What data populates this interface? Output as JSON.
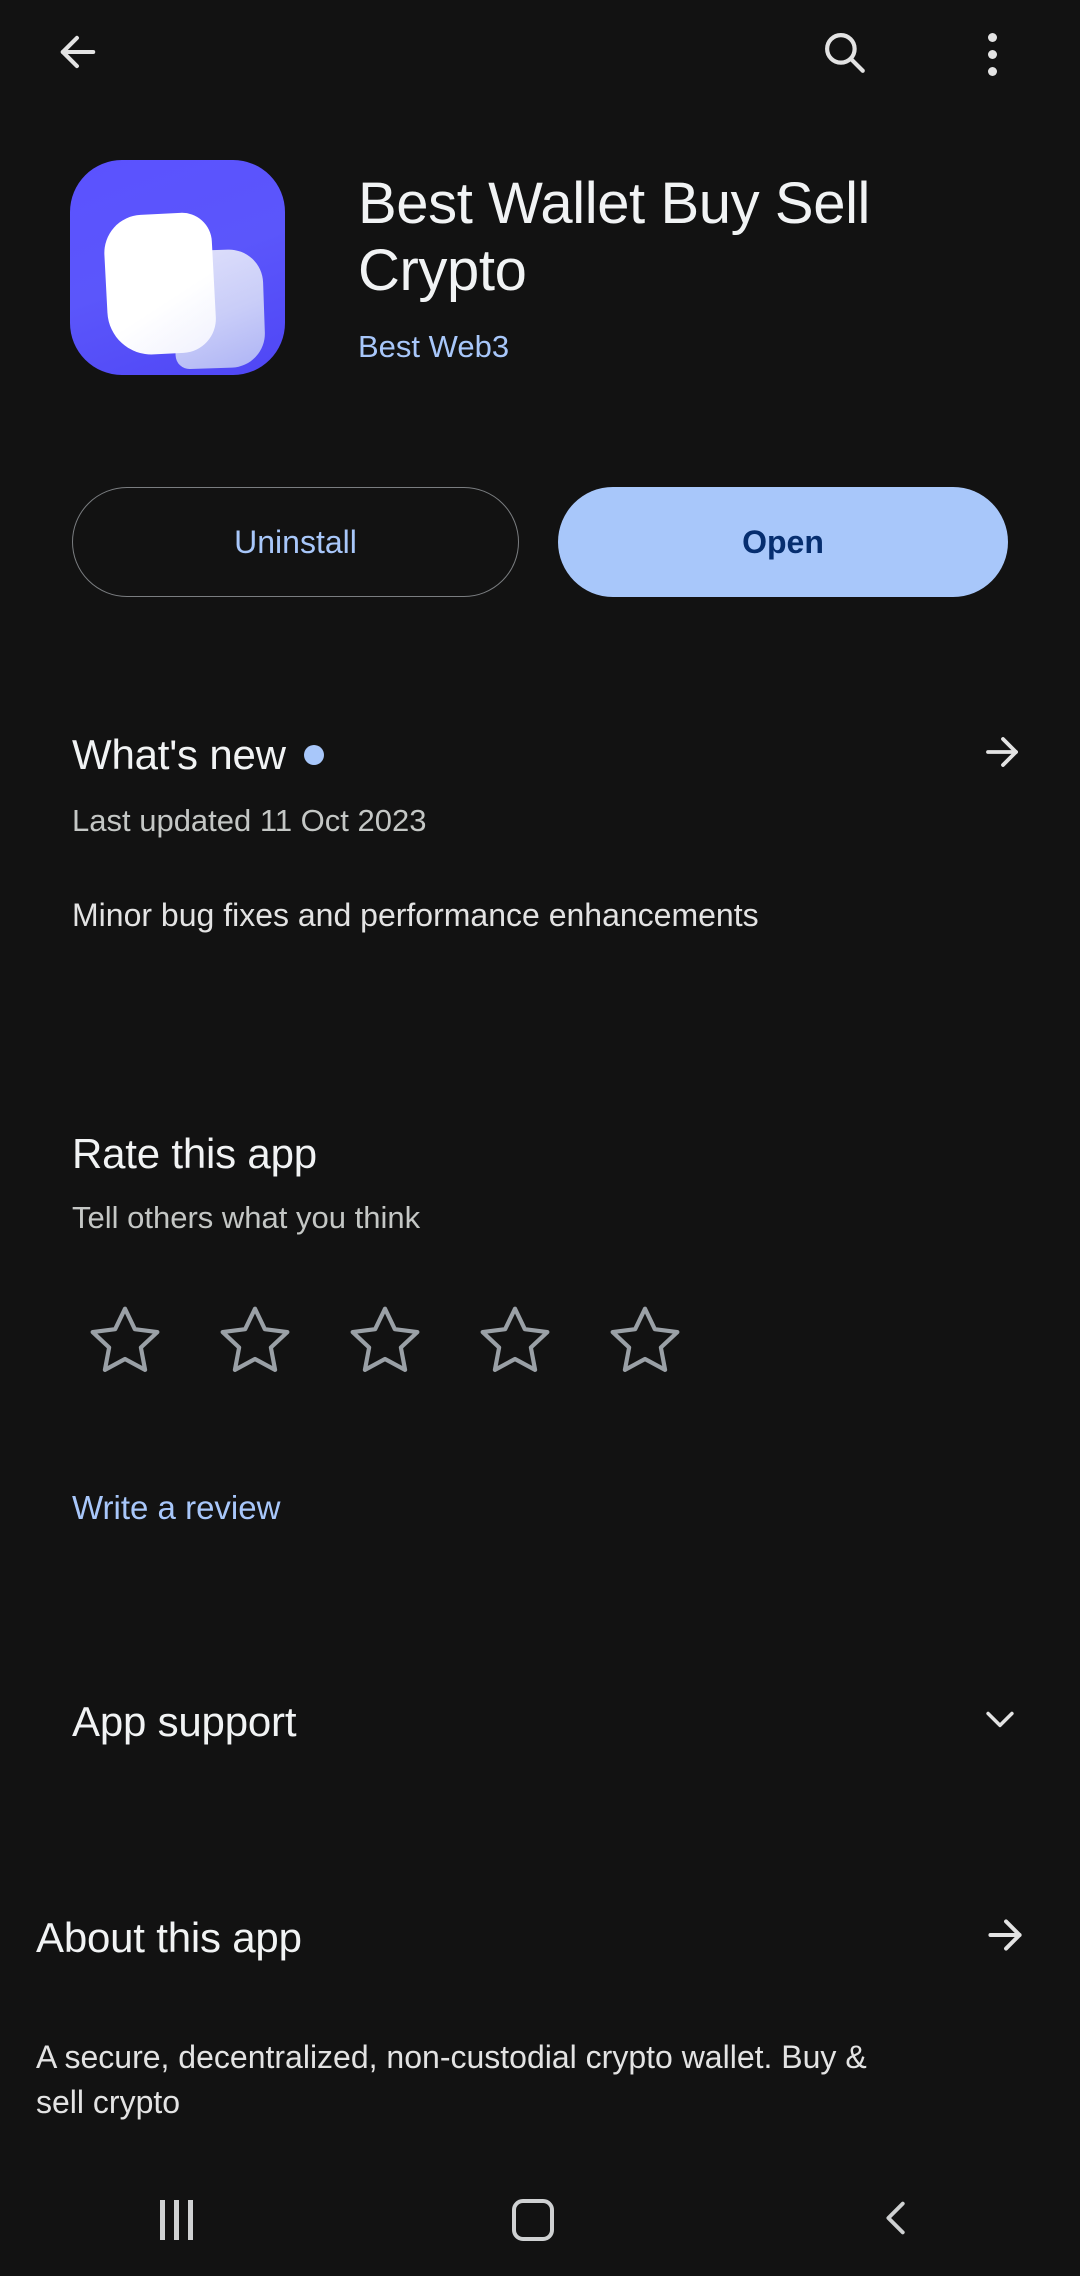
{
  "topbar": {
    "back_icon": "arrow-left-icon",
    "search_icon": "search-icon",
    "overflow_icon": "more-vert-icon"
  },
  "app": {
    "title": "Best Wallet Buy Sell Crypto",
    "developer": "Best Web3",
    "icon_bg": "#5b52ff",
    "icon_name": "best-wallet-app-icon"
  },
  "actions": {
    "uninstall_label": "Uninstall",
    "open_label": "Open"
  },
  "whats_new": {
    "title": "What's new",
    "badge": "new-dot",
    "last_updated": "Last updated 11 Oct 2023",
    "notes": "Minor bug fixes and performance enhancements",
    "arrow_icon": "arrow-right-icon"
  },
  "rate": {
    "title": "Rate this app",
    "subtitle": "Tell others what you think",
    "stars": [
      {
        "index": 1,
        "filled": false
      },
      {
        "index": 2,
        "filled": false
      },
      {
        "index": 3,
        "filled": false
      },
      {
        "index": 4,
        "filled": false
      },
      {
        "index": 5,
        "filled": false
      }
    ],
    "rating_value": 0,
    "write_review_label": "Write a review"
  },
  "app_support": {
    "title": "App support",
    "chevron_icon": "chevron-down-icon"
  },
  "about": {
    "title": "About this app",
    "arrow_icon": "arrow-right-icon",
    "description": "A secure, decentralized, non-custodial crypto wallet. Buy & sell crypto"
  },
  "navbar": {
    "recents_label": "recents",
    "home_label": "home",
    "back_label": "back"
  },
  "colors": {
    "background": "#121212",
    "accent_blue": "#a8c7fa",
    "text_primary": "#f1f3f4",
    "text_secondary": "#c4c7c5",
    "brand_purple": "#5b52ff"
  }
}
